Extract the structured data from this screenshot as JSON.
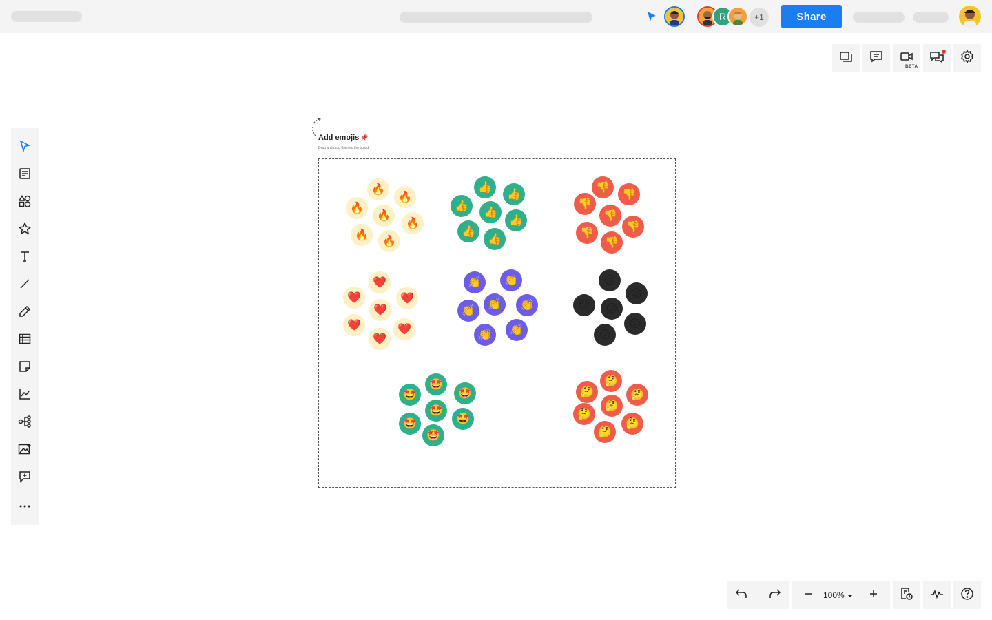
{
  "topbar": {
    "share_label": "Share",
    "collaborator_initial": "R",
    "extra_collaborators": "+1"
  },
  "right_toolbar": {
    "video_badge": "BETA",
    "items": [
      "pages-icon",
      "comment-icon",
      "video-icon",
      "chat-icon",
      "gear-icon"
    ]
  },
  "left_toolbar": {
    "items": [
      "select-icon",
      "templates-icon",
      "shapes-icon",
      "star-icon",
      "text-icon",
      "line-icon",
      "pen-icon",
      "table-icon",
      "sticky-note-icon",
      "chart-icon",
      "mind-map-icon",
      "image-icon",
      "add-comment-icon",
      "more-icon"
    ]
  },
  "board": {
    "frame_title": "Add emojis",
    "frame_title_emoji": "📌",
    "frame_subtitle": "Drag and drop this into the board.",
    "emoji_groups": [
      {
        "name": "fire",
        "emoji": "🔥",
        "color": "#fdf0c4"
      },
      {
        "name": "thumbs-up",
        "emoji": "👍",
        "color": "#2fb08a"
      },
      {
        "name": "thumbs-down",
        "emoji": "👎",
        "color": "#f05c4b"
      },
      {
        "name": "heart",
        "emoji": "❤️",
        "color": "#fdf0c4"
      },
      {
        "name": "clap",
        "emoji": "👏",
        "color": "#6c5ce7"
      },
      {
        "name": "confused",
        "emoji": "😕",
        "color": "#2b2b2b"
      },
      {
        "name": "star-struck",
        "emoji": "🤩",
        "color": "#2fb08a"
      },
      {
        "name": "thinking",
        "emoji": "🤔",
        "color": "#f05c4b"
      }
    ]
  },
  "bottom_toolbar": {
    "zoom": "100%"
  },
  "colors": {
    "accent": "#1a7ef0",
    "toolbar_bg": "#f4f4f4",
    "notification_dot": "#e53935"
  }
}
